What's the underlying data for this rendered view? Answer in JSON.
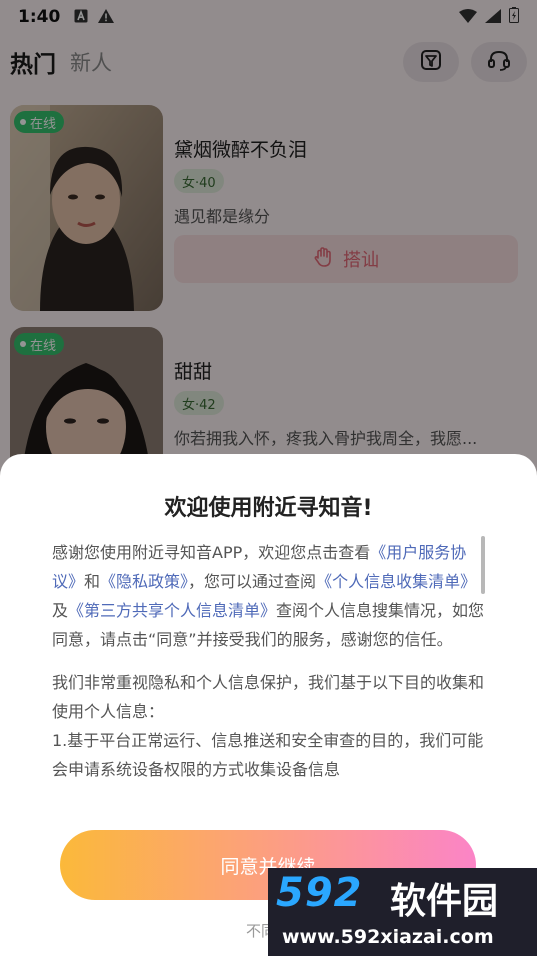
{
  "status_bar": {
    "time": "1:40"
  },
  "header": {
    "tab_hot": "热门",
    "tab_new": "新人"
  },
  "users": [
    {
      "online": "在线",
      "name": "黛烟微醉不负泪",
      "age": "女·40",
      "bio": "遇见都是缘分",
      "greet": "搭讪"
    },
    {
      "online": "在线",
      "name": "甜甜",
      "age": "女·42",
      "bio": "你若拥我入怀，疼我入骨护我周全，我愿..."
    }
  ],
  "dialog": {
    "title": "欢迎使用附近寻知音!",
    "p1_a": "感谢您使用附近寻知音APP，欢迎您点击查看",
    "p1_link1": "《用户服务协议》",
    "p1_b": "和",
    "p1_link2": "《隐私政策》",
    "p1_c": "，您可以通过查阅",
    "p1_link3": "《个人信息收集清单》",
    "p1_d": "及",
    "p1_link4": "《第三方共享个人信息清单》",
    "p1_e": "查阅个人信息搜集情况，如您同意，请点击“同意”并接受我们的服务，感谢您的信任。",
    "p2": "我们非常重视隐私和个人信息保护，我们基于以下目的收集和使用个人信息：",
    "p3": "1.基于平台正常运行、信息推送和安全审查的目的，我们可能会申请系统设备权限的方式收集设备信息",
    "agree": "同意并继续",
    "decline": "不同意"
  },
  "watermark": {
    "logo_num": "592",
    "logo_cn": "软件园",
    "url": "www.592xiazai.com"
  }
}
